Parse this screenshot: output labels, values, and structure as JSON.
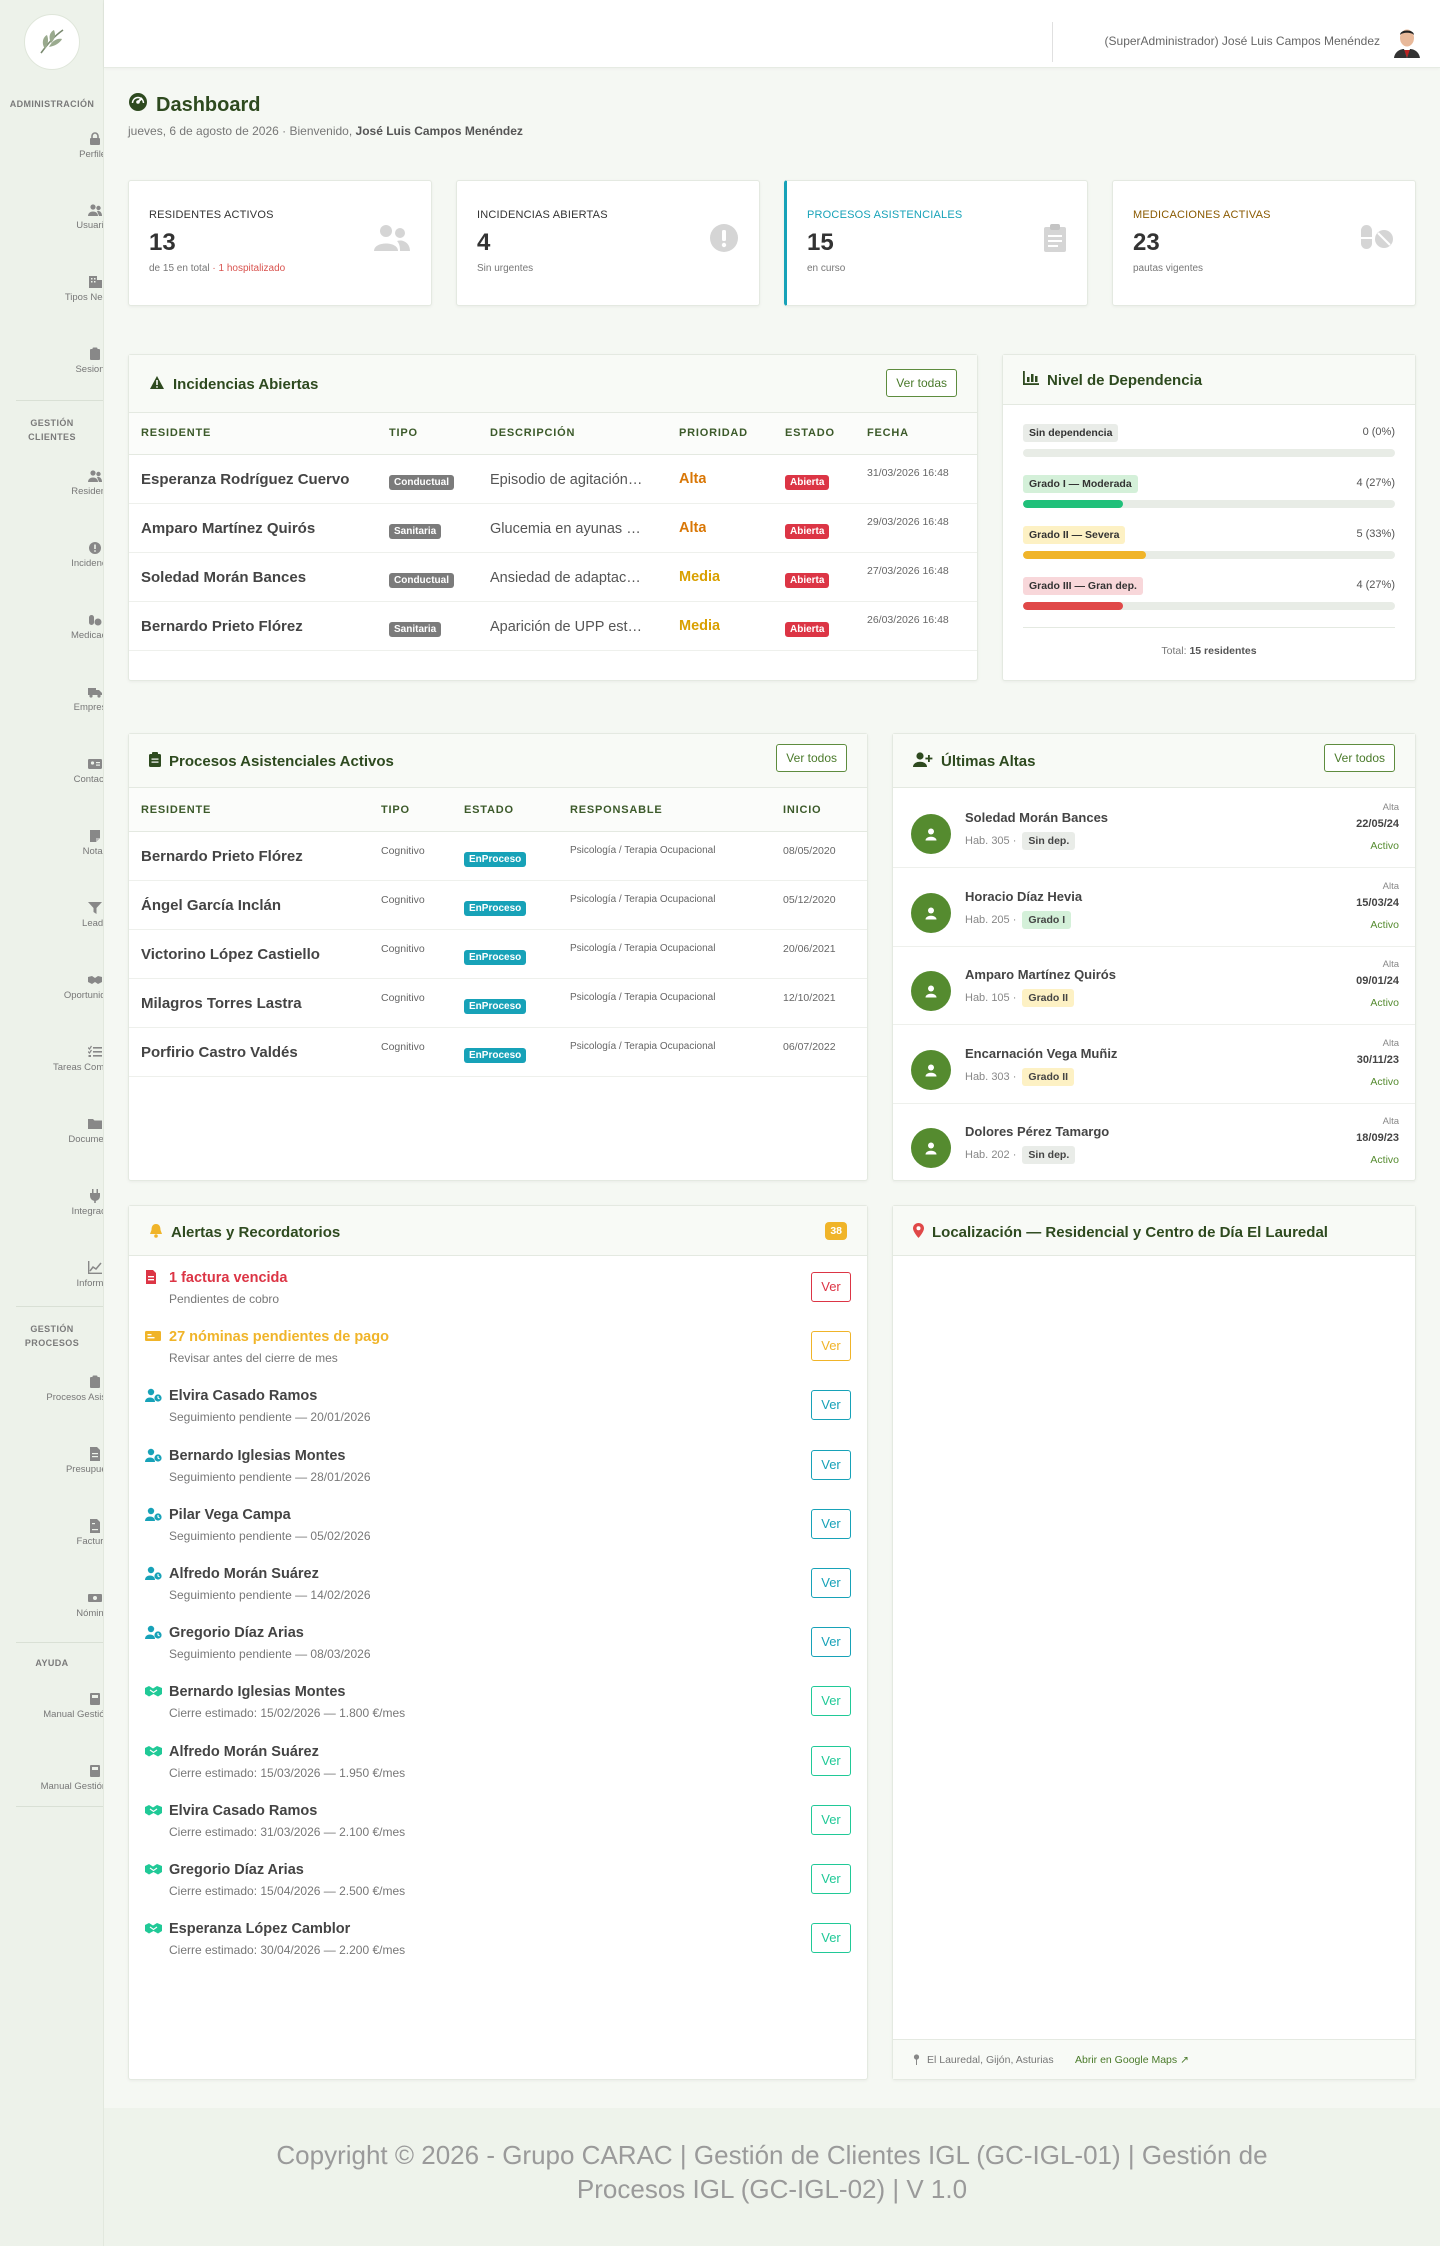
{
  "sidebar": {
    "sections": [
      {
        "label": "ADMINISTRACIÓN"
      },
      {
        "label": "GESTIÓN CLIENTES"
      },
      {
        "label": "GESTIÓN PROCESOS"
      },
      {
        "label": "AYUDA"
      }
    ],
    "items": [
      {
        "label": "Perfiles",
        "icon": "lock-icon"
      },
      {
        "label": "Usuarios",
        "icon": "users-icon"
      },
      {
        "label": "Tipos Negocio",
        "icon": "building-icon"
      },
      {
        "label": "Sesiones",
        "icon": "clipboard-icon"
      },
      {
        "label": "Residentes",
        "icon": "users-icon"
      },
      {
        "label": "Incidencias",
        "icon": "exclamation-icon"
      },
      {
        "label": "Medicación",
        "icon": "pills-icon"
      },
      {
        "label": "Empresas",
        "icon": "truck-icon"
      },
      {
        "label": "Contactos",
        "icon": "address-card-icon"
      },
      {
        "label": "Notas",
        "icon": "note-icon"
      },
      {
        "label": "Leads",
        "icon": "funnel-icon"
      },
      {
        "label": "Oportunidades",
        "icon": "handshake-icon"
      },
      {
        "label": "Tareas Comerciales",
        "icon": "tasks-icon"
      },
      {
        "label": "Documentos",
        "icon": "folder-icon"
      },
      {
        "label": "Integración",
        "icon": "plug-icon"
      },
      {
        "label": "Informes",
        "icon": "chart-line-icon"
      },
      {
        "label": "Procesos Asistenciales",
        "icon": "clipboard-icon"
      },
      {
        "label": "Presupuestos",
        "icon": "file-icon"
      },
      {
        "label": "Facturas",
        "icon": "invoice-icon"
      },
      {
        "label": "Nóminas",
        "icon": "money-icon"
      },
      {
        "label": "Manual Gestión Clientes",
        "icon": "book-icon"
      },
      {
        "label": "Manual Gestión Procesos",
        "icon": "book-icon"
      }
    ]
  },
  "topbar": {
    "user": "(SuperAdministrador) José Luis Campos Menéndez"
  },
  "header": {
    "title": "Dashboard",
    "date": "jueves, 6 de agosto de 2026",
    "welcome": "Bienvenido,",
    "user": "José Luis Campos Menéndez"
  },
  "stats": [
    {
      "label": "RESIDENTES ACTIVOS",
      "value": "13",
      "note": "de 15 en total",
      "extra": "· 1 hospitalizado",
      "color": "#333333"
    },
    {
      "label": "INCIDENCIAS ABIERTAS",
      "value": "4",
      "note": "Sin urgentes",
      "extra": "",
      "color": "#333333"
    },
    {
      "label": "PROCESOS ASISTENCIALES",
      "value": "15",
      "note": "en curso",
      "extra": "",
      "color": "#17a2b8"
    },
    {
      "label": "MEDICACIONES ACTIVAS",
      "value": "23",
      "note": "pautas vigentes",
      "extra": "",
      "color": "#8a5a00"
    }
  ],
  "incidencias": {
    "title": "Incidencias Abiertas",
    "button": "Ver todas",
    "columns": [
      "RESIDENTE",
      "TIPO",
      "DESCRIPCIÓN",
      "PRIORIDAD",
      "ESTADO",
      "FECHA"
    ],
    "rows": [
      {
        "residente": "Esperanza Rodríguez Cuervo",
        "tipo": "Conductual",
        "descripcion": "Episodio de agitación…",
        "prioridad": "Alta",
        "estado": "Abierta",
        "fecha": "31/03/2026 16:48"
      },
      {
        "residente": "Amparo Martínez Quirós",
        "tipo": "Sanitaria",
        "descripcion": "Glucemia en ayunas …",
        "prioridad": "Alta",
        "estado": "Abierta",
        "fecha": "29/03/2026 16:48"
      },
      {
        "residente": "Soledad Morán Bances",
        "tipo": "Conductual",
        "descripcion": "Ansiedad de adaptac…",
        "prioridad": "Media",
        "estado": "Abierta",
        "fecha": "27/03/2026 16:48"
      },
      {
        "residente": "Bernardo Prieto Flórez",
        "tipo": "Sanitaria",
        "descripcion": "Aparición de UPP est…",
        "prioridad": "Media",
        "estado": "Abierta",
        "fecha": "26/03/2026 16:48"
      }
    ]
  },
  "dependencia": {
    "title": "Nivel de Dependencia",
    "levels": [
      {
        "label": "Sin dependencia",
        "count": "0 (0%)",
        "pct": 0,
        "bg": "#e9ece8",
        "fill": "#9e9e9e"
      },
      {
        "label": "Grado I — Moderada",
        "count": "4 (27%)",
        "pct": 27,
        "bg": "#d4f0d9",
        "fill": "#20c07a"
      },
      {
        "label": "Grado II — Severa",
        "count": "5 (33%)",
        "pct": 33,
        "bg": "#fdf1c4",
        "fill": "#f0b429"
      },
      {
        "label": "Grado III — Gran dep.",
        "count": "4 (27%)",
        "pct": 27,
        "bg": "#f8d7da",
        "fill": "#e04848"
      }
    ],
    "total_label": "Total:",
    "total_value": "15 residentes"
  },
  "procesos": {
    "title": "Procesos Asistenciales Activos",
    "button": "Ver todos",
    "columns": [
      "RESIDENTE",
      "TIPO",
      "ESTADO",
      "RESPONSABLE",
      "INICIO"
    ],
    "rows": [
      {
        "residente": "Bernardo Prieto Flórez",
        "tipo": "Cognitivo",
        "estado": "EnProceso",
        "responsable": "Psicología / Terapia Ocupacional",
        "inicio": "08/05/2020"
      },
      {
        "residente": "Ángel García Inclán",
        "tipo": "Cognitivo",
        "estado": "EnProceso",
        "responsable": "Psicología / Terapia Ocupacional",
        "inicio": "05/12/2020"
      },
      {
        "residente": "Victorino López Castiello",
        "tipo": "Cognitivo",
        "estado": "EnProceso",
        "responsable": "Psicología / Terapia Ocupacional",
        "inicio": "20/06/2021"
      },
      {
        "residente": "Milagros Torres Lastra",
        "tipo": "Cognitivo",
        "estado": "EnProceso",
        "responsable": "Psicología / Terapia Ocupacional",
        "inicio": "12/10/2021"
      },
      {
        "residente": "Porfirio Castro Valdés",
        "tipo": "Cognitivo",
        "estado": "EnProceso",
        "responsable": "Psicología / Terapia Ocupacional",
        "inicio": "06/07/2022"
      }
    ]
  },
  "altas": {
    "title": "Últimas Altas",
    "button": "Ver todos",
    "hab_label": "Hab.",
    "alta_label": "Alta",
    "items": [
      {
        "name": "Soledad Morán Bances",
        "hab": "305",
        "grado": "Sin dep.",
        "grado_bg": "#e9ece8",
        "date": "22/05/24",
        "status": "Activo"
      },
      {
        "name": "Horacio Díaz Hevia",
        "hab": "205",
        "grado": "Grado I",
        "grado_bg": "#d4f0d9",
        "date": "15/03/24",
        "status": "Activo"
      },
      {
        "name": "Amparo Martínez Quirós",
        "hab": "105",
        "grado": "Grado II",
        "grado_bg": "#fdf1c4",
        "date": "09/01/24",
        "status": "Activo"
      },
      {
        "name": "Encarnación Vega Muñiz",
        "hab": "303",
        "grado": "Grado II",
        "grado_bg": "#fdf1c4",
        "date": "30/11/23",
        "status": "Activo"
      },
      {
        "name": "Dolores Pérez Tamargo",
        "hab": "202",
        "grado": "Sin dep.",
        "grado_bg": "#e9ece8",
        "date": "18/09/23",
        "status": "Activo"
      }
    ]
  },
  "alertas": {
    "title": "Alertas y Recordatorios",
    "count": "38",
    "button": "Ver",
    "items": [
      {
        "title": "1 factura vencida",
        "sub": "Pendientes de cobro",
        "icon": "invoice-icon",
        "color": "#dc3545"
      },
      {
        "title": "27 nóminas pendientes de pago",
        "sub": "Revisar antes del cierre de mes",
        "icon": "money-icon",
        "color": "#f0b429"
      },
      {
        "title": "Elvira Casado Ramos",
        "sub": "Seguimiento pendiente — 20/01/2026",
        "icon": "user-clock-icon",
        "color": "#17a2b8"
      },
      {
        "title": "Bernardo Iglesias Montes",
        "sub": "Seguimiento pendiente — 28/01/2026",
        "icon": "user-clock-icon",
        "color": "#17a2b8"
      },
      {
        "title": "Pilar Vega Campa",
        "sub": "Seguimiento pendiente — 05/02/2026",
        "icon": "user-clock-icon",
        "color": "#17a2b8"
      },
      {
        "title": "Alfredo Morán Suárez",
        "sub": "Seguimiento pendiente — 14/02/2026",
        "icon": "user-clock-icon",
        "color": "#17a2b8"
      },
      {
        "title": "Gregorio Díaz Arias",
        "sub": "Seguimiento pendiente — 08/03/2026",
        "icon": "user-clock-icon",
        "color": "#17a2b8"
      },
      {
        "title": "Bernardo Iglesias Montes",
        "sub": "Cierre estimado: 15/02/2026 — 1.800 €/mes",
        "icon": "handshake-icon",
        "color": "#20c997"
      },
      {
        "title": "Alfredo Morán Suárez",
        "sub": "Cierre estimado: 15/03/2026 — 1.950 €/mes",
        "icon": "handshake-icon",
        "color": "#20c997"
      },
      {
        "title": "Elvira Casado Ramos",
        "sub": "Cierre estimado: 31/03/2026 — 2.100 €/mes",
        "icon": "handshake-icon",
        "color": "#20c997"
      },
      {
        "title": "Gregorio Díaz Arias",
        "sub": "Cierre estimado: 15/04/2026 — 2.500 €/mes",
        "icon": "handshake-icon",
        "color": "#20c997"
      },
      {
        "title": "Esperanza López Camblor",
        "sub": "Cierre estimado: 30/04/2026 — 2.200 €/mes",
        "icon": "handshake-icon",
        "color": "#20c997"
      }
    ]
  },
  "mapa": {
    "title": "Localización — Residencial y Centro de Día El Lauredal",
    "address": "El Lauredal, Gijón, Asturias",
    "link": "Abrir en Google Maps"
  },
  "footer": {
    "text": "Copyright © 2026 - Grupo CARAC | Gestión de Clientes IGL (GC-IGL-01) | Gestión de Procesos IGL (GC-IGL-02) | V 1.0"
  }
}
